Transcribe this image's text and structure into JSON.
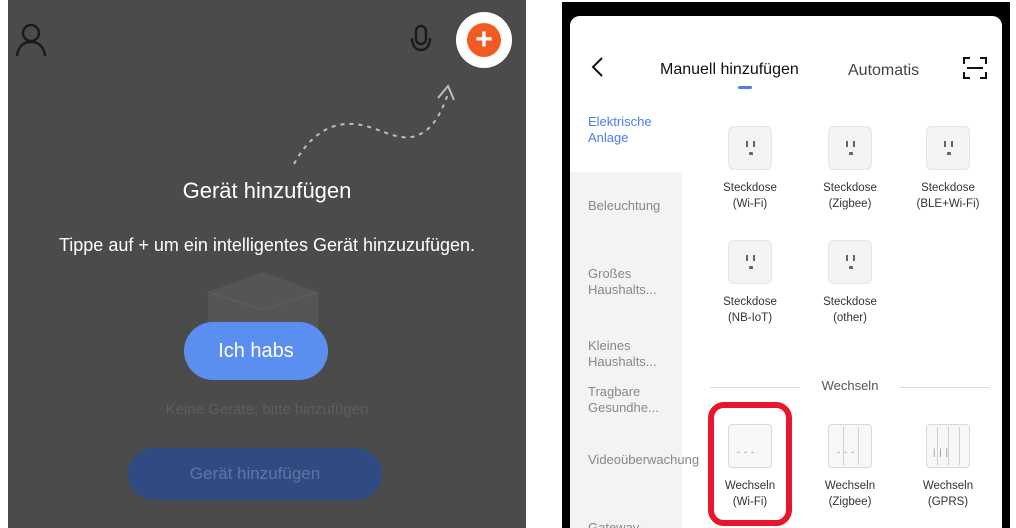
{
  "left_panel": {
    "title": "Gerät hinzufügen",
    "description": "Tippe auf + um ein intelligentes Gerät hinzuzufügen.",
    "primary_button": "Ich habs",
    "empty_text": "Keine Geräte; bitte hinzufügen",
    "add_button": "Gerät hinzufügen",
    "icons": [
      "user-icon",
      "microphone-icon",
      "add-icon"
    ],
    "colors": {
      "background": "#4b4b4b",
      "accent": "#f25a25",
      "button": "#5a8ef0"
    }
  },
  "right_panel": {
    "header": {
      "tab_manual": "Manuell hinzufügen",
      "tab_auto": "Automatis",
      "icons": [
        "back-icon",
        "scan-icon"
      ]
    },
    "sidebar": [
      {
        "label": "Elektrische Anlage",
        "active": true
      },
      {
        "label": "Beleuchtung"
      },
      {
        "label": "Großes Haushalts..."
      },
      {
        "label": "Kleines Haushalts..."
      },
      {
        "label": "Tragbare Gesundhe..."
      },
      {
        "label": "Videoüberwachung"
      },
      {
        "label": "Gateway-"
      }
    ],
    "devices": [
      {
        "line1": "Steckdose",
        "line2": "(Wi-Fi)"
      },
      {
        "line1": "Steckdose",
        "line2": "(Zigbee)"
      },
      {
        "line1": "Steckdose",
        "line2": "(BLE+Wi-Fi)"
      },
      {
        "line1": "Steckdose",
        "line2": "(NB-IoT)"
      },
      {
        "line1": "Steckdose",
        "line2": "(other)"
      }
    ],
    "section_title": "Wechseln",
    "switches": [
      {
        "line1": "Wechseln",
        "line2": "(Wi-Fi)"
      },
      {
        "line1": "Wechseln",
        "line2": "(Zigbee)"
      },
      {
        "line1": "Wechseln",
        "line2": "(GPRS)"
      }
    ],
    "colors": {
      "accent": "#4a7ef0",
      "highlight": "#e8162c"
    }
  }
}
